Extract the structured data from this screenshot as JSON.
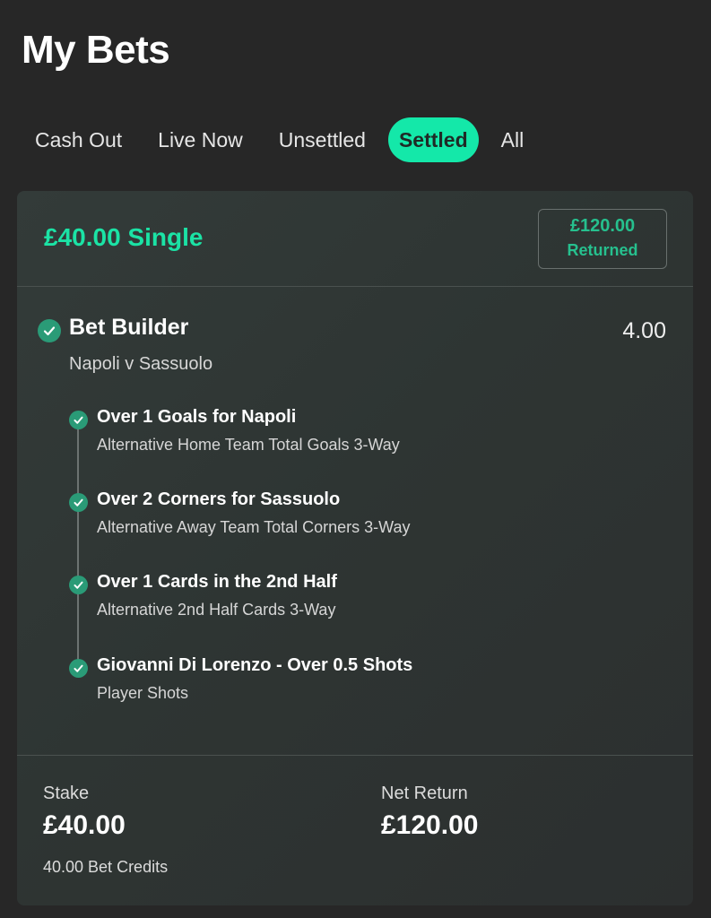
{
  "page": {
    "title": "My Bets"
  },
  "tabs": [
    {
      "label": "Cash Out",
      "active": false
    },
    {
      "label": "Live Now",
      "active": false
    },
    {
      "label": "Unsettled",
      "active": false
    },
    {
      "label": "Settled",
      "active": true
    },
    {
      "label": "All",
      "active": false
    }
  ],
  "bet": {
    "title": "£40.00 Single",
    "returned_amount": "£120.00",
    "returned_label": "Returned",
    "builder": {
      "title": "Bet Builder",
      "odds": "4.00",
      "match": "Napoli v Sassuolo",
      "status_icon": "check-circle-icon"
    },
    "legs": [
      {
        "title": "Over 1 Goals for Napoli",
        "market": "Alternative Home Team Total Goals 3-Way",
        "status_icon": "check-circle-icon"
      },
      {
        "title": "Over 2 Corners for Sassuolo",
        "market": "Alternative Away Team Total Corners 3-Way",
        "status_icon": "check-circle-icon"
      },
      {
        "title": "Over 1 Cards in the 2nd Half",
        "market": "Alternative 2nd Half Cards 3-Way",
        "status_icon": "check-circle-icon"
      },
      {
        "title": "Giovanni Di Lorenzo - Over 0.5 Shots",
        "market": "Player Shots",
        "status_icon": "check-circle-icon"
      }
    ],
    "stake_label": "Stake",
    "stake_value": "£40.00",
    "stake_note": "40.00 Bet Credits",
    "net_return_label": "Net Return",
    "net_return_value": "£120.00"
  },
  "colors": {
    "background": "#272727",
    "accent": "#14e8a9",
    "bet_title": "#1be3a5",
    "returned_text": "#26c08e",
    "check_fill": "#2a9b77"
  }
}
